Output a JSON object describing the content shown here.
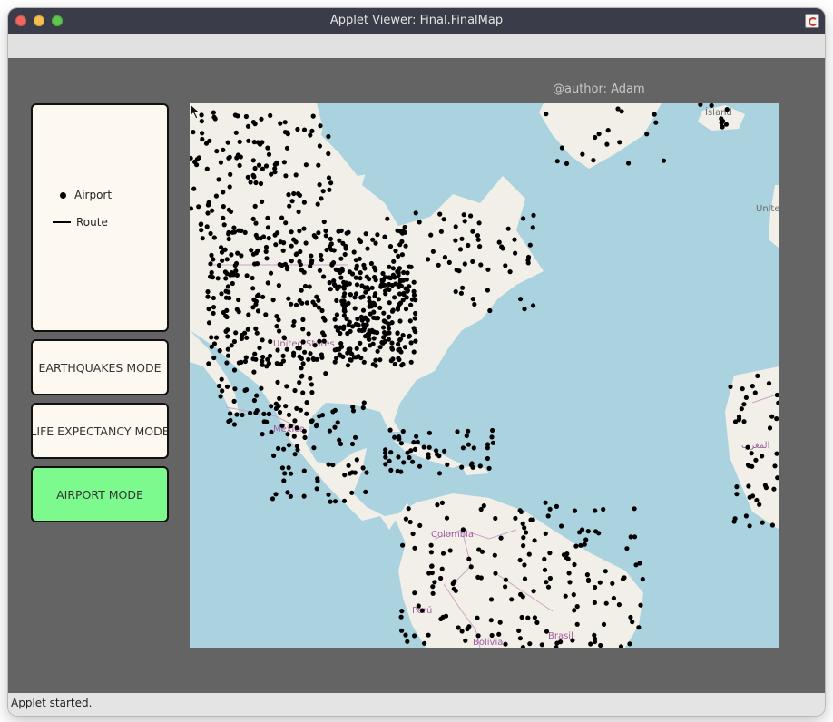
{
  "window": {
    "title": "Applet Viewer: Final.FinalMap",
    "status": "Applet started."
  },
  "canvas": {
    "author": "@author: Adam"
  },
  "legend": {
    "items": [
      {
        "symbol": "dot",
        "label": "Airport"
      },
      {
        "symbol": "line",
        "label": "Route"
      }
    ]
  },
  "modes": [
    {
      "label": "EARTHQUAKES MODE",
      "active": false
    },
    {
      "label": "LIFE EXPECTANCY MODE",
      "active": false
    },
    {
      "label": "AIRPORT MODE",
      "active": true
    }
  ],
  "map": {
    "labels": {
      "iceland": "Ísland",
      "uk": "United",
      "usa": "United States",
      "mexico": "México",
      "colombia": "Colombia",
      "peru": "Perú",
      "bolivia": "Bolivia",
      "brazil": "Brasil",
      "morocco": "المغرب"
    },
    "colors": {
      "ocean": "#aad3df",
      "land": "#f2efe9",
      "airport": "#000000",
      "border": "#c9a3c9",
      "active_mode": "#7dfa8d"
    }
  }
}
